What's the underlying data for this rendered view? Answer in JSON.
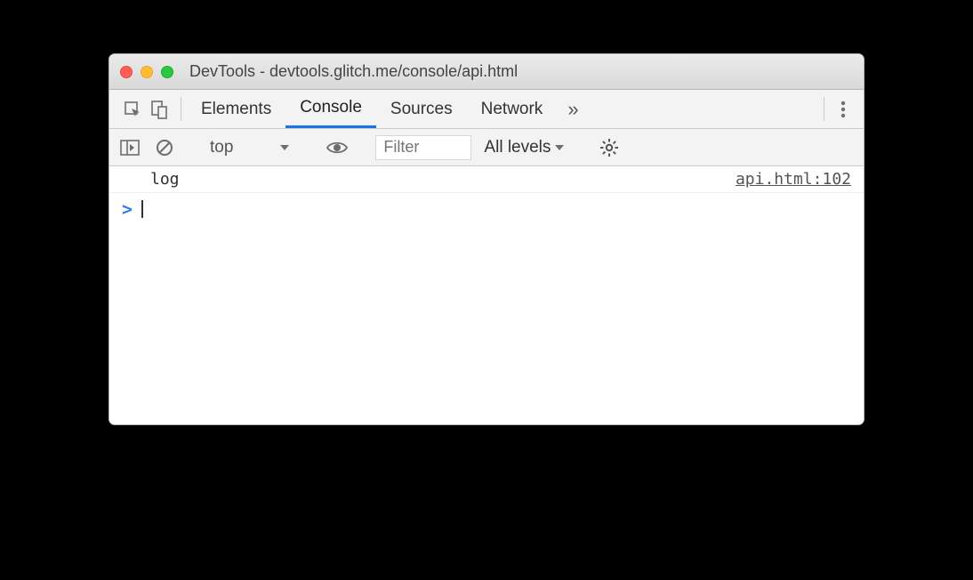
{
  "window": {
    "title": "DevTools - devtools.glitch.me/console/api.html"
  },
  "tabs": {
    "elements": "Elements",
    "console": "Console",
    "sources": "Sources",
    "network": "Network",
    "more": "»"
  },
  "toolbar": {
    "context": "top",
    "filter_placeholder": "Filter",
    "levels": "All levels"
  },
  "console": {
    "log_msg": "log",
    "log_source": "api.html:102",
    "prompt": ">"
  }
}
